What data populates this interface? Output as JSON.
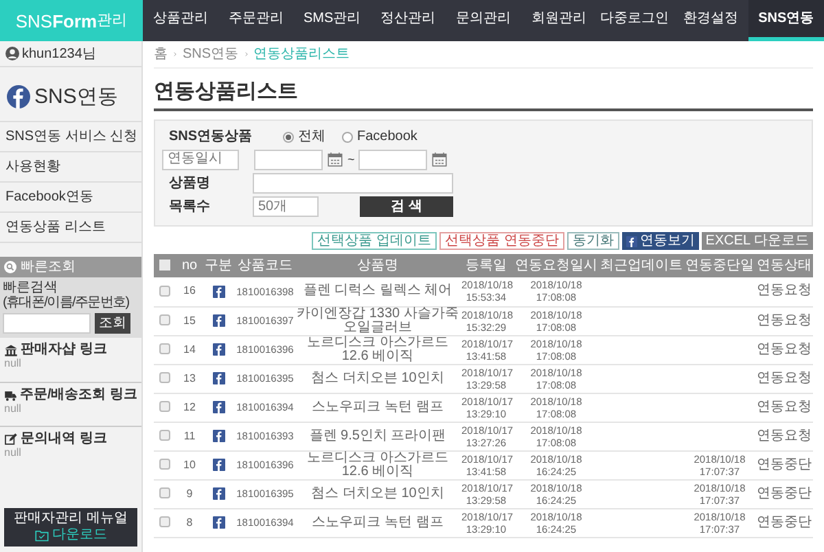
{
  "logo": {
    "light": "SNS",
    "bold": "Form",
    "suffix": "관리"
  },
  "nav": [
    {
      "label": "상품관리",
      "selected": false
    },
    {
      "label": "주문관리",
      "selected": false
    },
    {
      "label": "SMS관리",
      "selected": false
    },
    {
      "label": "정산관리",
      "selected": false
    },
    {
      "label": "문의관리",
      "selected": false
    },
    {
      "label": "회원관리",
      "selected": false
    },
    {
      "label": "다중로그인",
      "selected": false
    },
    {
      "label": "환경설정",
      "selected": false
    },
    {
      "label": "SNS연동",
      "selected": true
    }
  ],
  "user": "khun1234님",
  "sidebar": {
    "title": "SNS연동",
    "items": [
      {
        "label": "SNS연동 서비스 신청"
      },
      {
        "label": "사용현황"
      },
      {
        "label": "Facebook연동"
      },
      {
        "label": "연동상품 리스트"
      }
    ],
    "quick_search": {
      "title": "빠른조회",
      "label": "빠른검색",
      "hint": "(휴대폰/이름/주문번호)",
      "button": "조회"
    },
    "links": [
      {
        "kind": "shop",
        "label": "판매자샵 링크",
        "value": "null"
      },
      {
        "kind": "delivery",
        "label": "주문/배송조회 링크",
        "value": "null"
      },
      {
        "kind": "inquiry",
        "label": "문의내역 링크",
        "value": "null"
      }
    ],
    "manual": {
      "label": "판매자관리 메뉴얼",
      "badge": "다운로드"
    }
  },
  "breadcrumb": [
    "홈",
    "SNS연동",
    "연동상품리스트"
  ],
  "title": "연동상품리스트",
  "filter": {
    "sns_label": "SNS연동상품",
    "options": [
      {
        "label": "전체",
        "selected": true
      },
      {
        "label": "Facebook",
        "selected": false
      }
    ],
    "date_select": "연동일시",
    "date_separator": "~",
    "name_label": "상품명",
    "count_label": "목록수",
    "count_select": "50개",
    "search_button": "검 색"
  },
  "actions": [
    {
      "kind": "teal",
      "label": "선택상품 업데이트"
    },
    {
      "kind": "red",
      "label": "선택상품 연동중단"
    },
    {
      "kind": "plain",
      "label": "동기화"
    },
    {
      "kind": "facebook",
      "label": "연동보기"
    },
    {
      "kind": "gray",
      "label": "EXCEL 다운로드"
    }
  ],
  "table": {
    "select_all_checked": false,
    "columns": [
      "no",
      "구분",
      "상품코드",
      "상품명",
      "등록일",
      "연동요청일시",
      "최근업데이트",
      "연동중단일",
      "연동상태"
    ],
    "rows": [
      {
        "checked": false,
        "no": "16",
        "code": "1810016398",
        "name": "플렌 디럭스 릴렉스 체어",
        "registered": "2018/10/18 15:53:34",
        "requested": "2018/10/18 17:08:08",
        "status": "연동요청"
      },
      {
        "checked": false,
        "no": "15",
        "code": "1810016397",
        "name": "카이엔장갑 1330 사슬가죽 오일글러브",
        "registered": "2018/10/18 15:32:29",
        "requested": "2018/10/18 17:08:08",
        "status": "연동요청"
      },
      {
        "checked": false,
        "no": "14",
        "code": "1810016396",
        "name": "노르디스크 아스가르드 12.6 베이직",
        "registered": "2018/10/17 13:41:58",
        "requested": "2018/10/18 17:08:08",
        "status": "연동요청"
      },
      {
        "checked": false,
        "no": "13",
        "code": "1810016395",
        "name": "첨스 더치오븐 10인치",
        "registered": "2018/10/17 13:29:58",
        "requested": "2018/10/18 17:08:08",
        "status": "연동요청"
      },
      {
        "checked": false,
        "no": "12",
        "code": "1810016394",
        "name": "스노우피크 녹턴 램프",
        "registered": "2018/10/17 13:29:10",
        "requested": "2018/10/18 17:08:08",
        "status": "연동요청"
      },
      {
        "checked": false,
        "no": "11",
        "code": "1810016393",
        "name": "플렌 9.5인치 프라이팬",
        "registered": "2018/10/17 13:27:26",
        "requested": "2018/10/18 17:08:08",
        "status": "연동요청"
      },
      {
        "checked": false,
        "no": "10",
        "code": "1810016396",
        "name": "노르디스크 아스가르드 12.6 베이직",
        "registered": "2018/10/17 13:41:58",
        "requested": "2018/10/18 16:24:25",
        "stopped": "2018/10/18 17:07:37",
        "status": "연동중단"
      },
      {
        "checked": false,
        "no": "9",
        "code": "1810016395",
        "name": "첨스 더치오븐 10인치",
        "registered": "2018/10/17 13:29:58",
        "requested": "2018/10/18 16:24:25",
        "stopped": "2018/10/18 17:07:37",
        "status": "연동중단"
      },
      {
        "checked": false,
        "no": "8",
        "code": "1810016394",
        "name": "스노우피크 녹턴 램프",
        "registered": "2018/10/17 13:29:10",
        "requested": "2018/10/18 16:24:25",
        "stopped": "2018/10/18 17:07:37",
        "status": "연동중단"
      }
    ]
  }
}
